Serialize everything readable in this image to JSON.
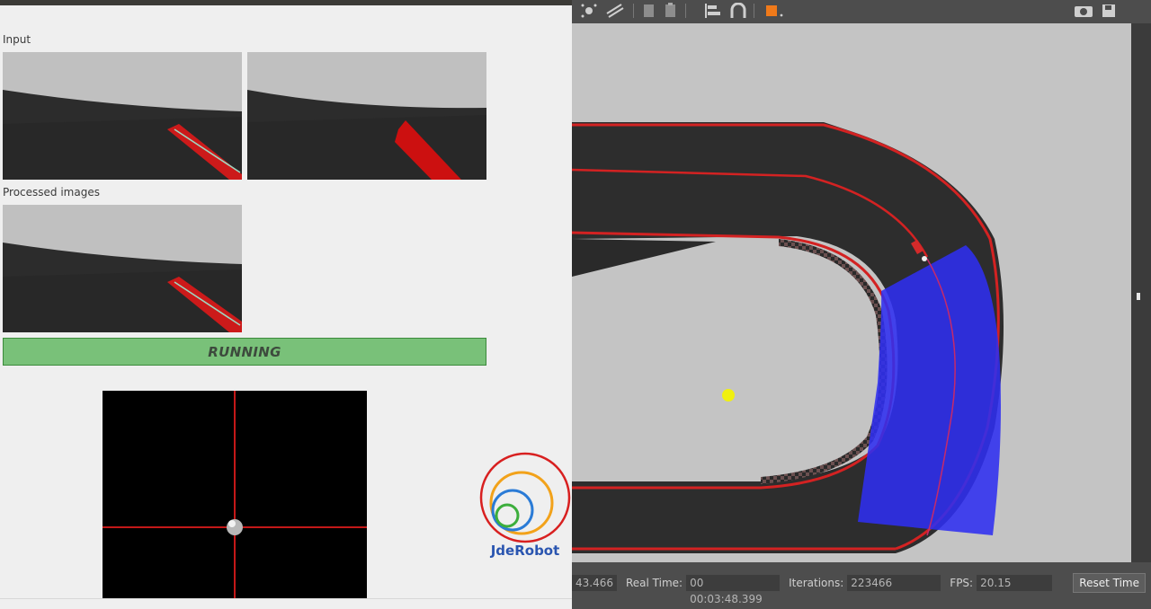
{
  "left_panel": {
    "input_label": "Input",
    "processed_label": "Processed images",
    "status": {
      "label": "RUNNING",
      "color": "#79c179"
    },
    "logo_text": "JdeRobot"
  },
  "gazebo": {
    "toolbar_icons": [
      "lights-icon",
      "lines-icon",
      "copy-icon",
      "paste-icon",
      "align-icon",
      "magnet-icon",
      "box-orange-icon",
      "screenshot-icon",
      "save-icon"
    ],
    "status": {
      "sim_time_value": "43.466",
      "real_time_label": "Real Time:",
      "real_time_value": "00 00:03:48.399",
      "iterations_label": "Iterations:",
      "iterations_value": "223466",
      "fps_label": "FPS:",
      "fps_value": "20.15",
      "reset_label": "Reset Time"
    }
  },
  "colors": {
    "track": "#2d2d2d",
    "line": "#d32222",
    "laser": "#2f2ff0",
    "ground": "#c4c4c4"
  }
}
